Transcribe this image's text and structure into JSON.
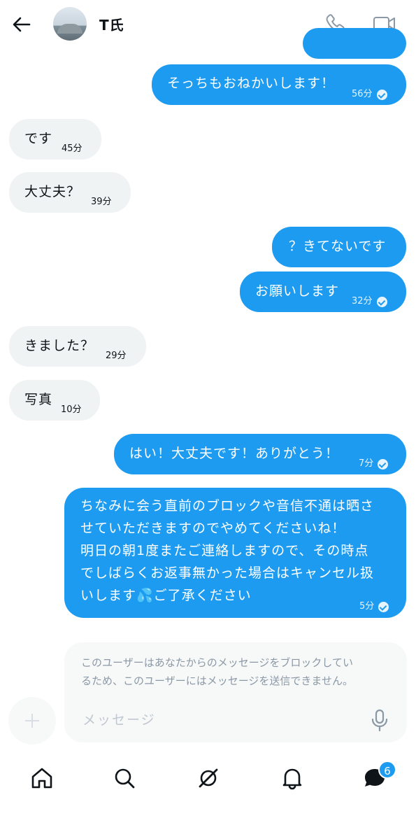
{
  "header": {
    "title": "T氏"
  },
  "messages": [
    {
      "side": "sent",
      "text": "そっちもおねかいします！",
      "time": "56分"
    },
    {
      "side": "recv",
      "text": "です",
      "time": "45分"
    },
    {
      "side": "recv",
      "text": "大丈夫？",
      "time": "39分"
    },
    {
      "side": "sent",
      "text": "？きてないです",
      "time": ""
    },
    {
      "side": "sent",
      "text": "お願いします",
      "time": "32分"
    },
    {
      "side": "recv",
      "text": "きました？",
      "time": "29分"
    },
    {
      "side": "recv",
      "text": "写真",
      "time": "10分"
    },
    {
      "side": "sent",
      "text": "はい！大丈夫です！ありがとう！",
      "time": "7分"
    },
    {
      "side": "sent",
      "lines": [
        "ちなみに会う直前のブロックや音信不通は晒さ",
        "せていただきますのでやめてくださいね！",
        "明日の朝1度またご連絡しますので、その時点",
        "でしばらくお返事無かった場合はキャンセル扱",
        "いします💦ご了承ください"
      ],
      "time": "5分"
    }
  ],
  "composer": {
    "blocked_notice": "このユーザーはあなたからのメッセージをブロックしてい\nるため、このユーザーにはメッセージを送信できません。",
    "placeholder": "メッセージ"
  },
  "nav": {
    "items": [
      "home-icon",
      "search-icon",
      "grok-icon",
      "notifications-icon",
      "messages-icon"
    ],
    "messages_badge": "6"
  },
  "colors": {
    "accent": "#1d9bf0",
    "received_bubble": "#eff3f4"
  }
}
